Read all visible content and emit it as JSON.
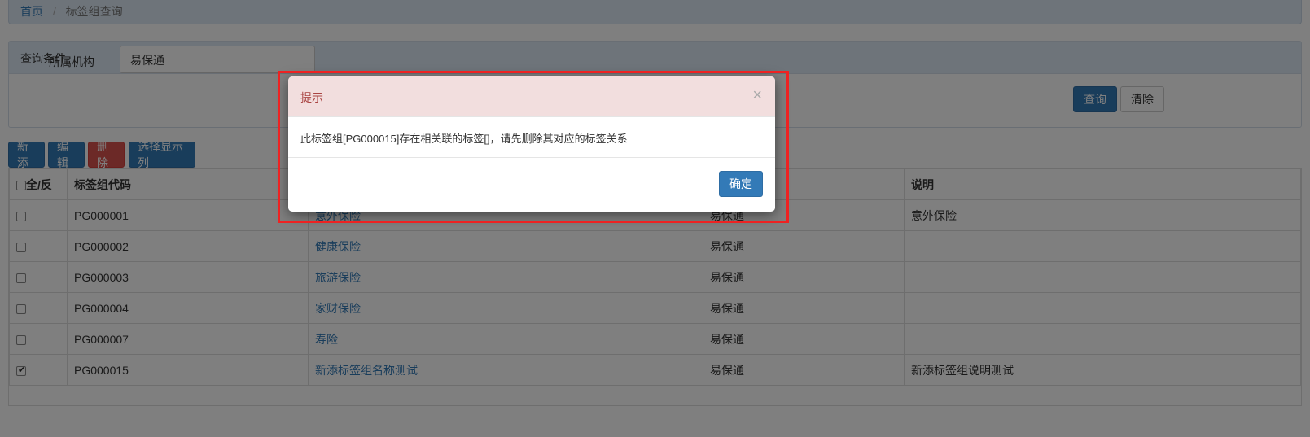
{
  "breadcrumb": {
    "home": "首页",
    "separator": "/",
    "current": "标签组查询"
  },
  "query_panel": {
    "title": "查询条件",
    "org_label": "所属机构",
    "org_value": "易保通",
    "search_button": "查询",
    "clear_button": "清除"
  },
  "toolbar": {
    "add": "新添",
    "edit": "编辑",
    "delete": "删除",
    "columns": "选择显示列"
  },
  "table": {
    "headers": [
      "全/反",
      "标签组代码",
      "",
      "",
      "说明"
    ],
    "rows": [
      {
        "code": "PG000001",
        "name": "意外保险",
        "org": "易保通",
        "desc": "意外保险",
        "checked": false
      },
      {
        "code": "PG000002",
        "name": "健康保险",
        "org": "易保通",
        "desc": "",
        "checked": false
      },
      {
        "code": "PG000003",
        "name": "旅游保险",
        "org": "易保通",
        "desc": "",
        "checked": false
      },
      {
        "code": "PG000004",
        "name": "家财保险",
        "org": "易保通",
        "desc": "",
        "checked": false
      },
      {
        "code": "PG000007",
        "name": "寿险",
        "org": "易保通",
        "desc": "",
        "checked": false
      },
      {
        "code": "PG000015",
        "name": "新添标签组名称测试",
        "org": "易保通",
        "desc": "新添标签组说明测试",
        "checked": true
      }
    ]
  },
  "modal": {
    "title": "提示",
    "close": "×",
    "message": "此标签组[PG000015]存在相关联的标签[]，请先删除其对应的标签关系",
    "confirm": "确定"
  },
  "colors": {
    "primary": "#337ab7",
    "danger": "#d9534f",
    "modal_header_bg": "#f2dede",
    "modal_title": "#a94442",
    "highlight": "#ee2222"
  }
}
